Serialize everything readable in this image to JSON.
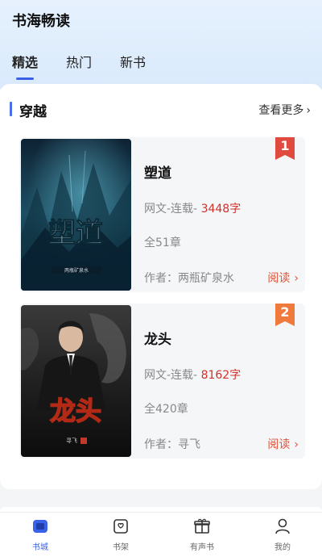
{
  "app": {
    "title": "书海畅读"
  },
  "tabs": [
    {
      "label": "精选",
      "active": true
    },
    {
      "label": "热门",
      "active": false
    },
    {
      "label": "新书",
      "active": false
    }
  ],
  "section": {
    "title": "穿越",
    "more": "查看更多"
  },
  "books": [
    {
      "rank": "1",
      "title": "塑道",
      "meta_prefix": "网文-连载-",
      "words": "3448字",
      "chapters": "全51章",
      "author": "作者：两瓶矿泉水",
      "read": "阅读",
      "cover_text": "塑道",
      "cover_author": "两瓶矿泉水",
      "rank_color": "#e04a3f"
    },
    {
      "rank": "2",
      "title": "龙头",
      "meta_prefix": "网文-连载-",
      "words": "8162字",
      "chapters": "全420章",
      "author": "作者：寻飞",
      "read": "阅读",
      "cover_text": "龙头",
      "cover_author": "寻飞",
      "rank_color": "#f07a3c"
    }
  ],
  "nav": [
    {
      "label": "书城",
      "icon": "store-icon",
      "active": true
    },
    {
      "label": "书架",
      "icon": "bookshelf-icon",
      "active": false
    },
    {
      "label": "有声书",
      "icon": "gift-icon",
      "active": false
    },
    {
      "label": "我的",
      "icon": "profile-icon",
      "active": false
    }
  ],
  "colors": {
    "accent": "#3a62e8",
    "price_red": "#d0312d",
    "read_link": "#e0533a"
  }
}
